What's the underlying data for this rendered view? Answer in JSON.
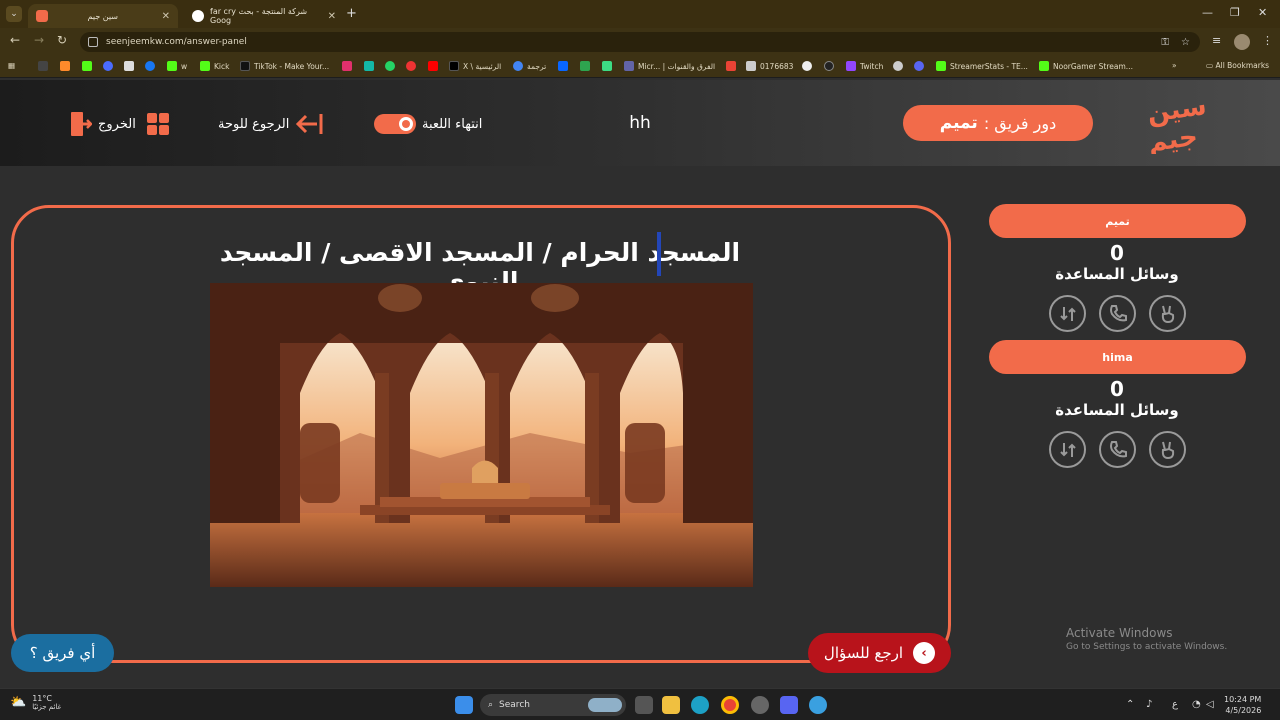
{
  "browser": {
    "tabs": [
      {
        "title": "سين جيم",
        "active": true
      },
      {
        "title": "far cry شركة المنتجة - بحث Goog",
        "active": false
      }
    ],
    "url": "seenjeemkw.com/answer-panel",
    "bookmarks": [
      {
        "label": "Kick",
        "color": "#53fc18"
      },
      {
        "label": "TikTok - Make Your...",
        "color": "#111111"
      },
      {
        "label": "X \\ الرئيسية",
        "color": "#000000"
      },
      {
        "label": "ترجمة",
        "color": "#4285f4"
      },
      {
        "label": "Micr... | الفرق والقنوات",
        "color": "#6264a7"
      },
      {
        "label": "0176683",
        "color": "#cccccc"
      },
      {
        "label": "Twitch",
        "color": "#9146ff"
      },
      {
        "label": "StreamerStats - TE...",
        "color": "#53fc18"
      },
      {
        "label": "NoorGamer Stream...",
        "color": "#53fc18"
      }
    ],
    "all_bookmarks": "All Bookmarks"
  },
  "header": {
    "logo_text": "سين جيم",
    "turn_label": "دور فريق :",
    "turn_team": "تميم",
    "game_name": "hh",
    "end_game": "انتهاء اللعبة",
    "back_to_board": "الرجوع للوحة",
    "exit": "الخروج"
  },
  "question": {
    "answer": "المسجد الحرام / المسجد الاقصى / المسجد النبوي",
    "back_to_question": "ارجع للسؤال",
    "which_team": "أي فريق ؟"
  },
  "teams": [
    {
      "name": "تميم",
      "score": "0",
      "helps_label": "وسائل المساعدة",
      "helps": [
        "two-answers-icon",
        "call-friend-icon",
        "swap-question-icon"
      ]
    },
    {
      "name": "hima",
      "score": "0",
      "helps_label": "وسائل المساعدة",
      "helps": [
        "two-answers-icon",
        "call-friend-icon",
        "swap-question-icon"
      ]
    }
  ],
  "watermark": {
    "line1": "Activate Windows",
    "line2": "Go to Settings to activate Windows."
  },
  "taskbar": {
    "weather_temp": "11°C",
    "weather_desc": "غائم جزئيًا",
    "search": "Search",
    "time": "10:24 PM",
    "date": "4/5/2026",
    "lang": "ع"
  },
  "colors": {
    "accent": "#f26b4a",
    "back_button": "#b8131b",
    "which_button": "#1b6ea0"
  }
}
